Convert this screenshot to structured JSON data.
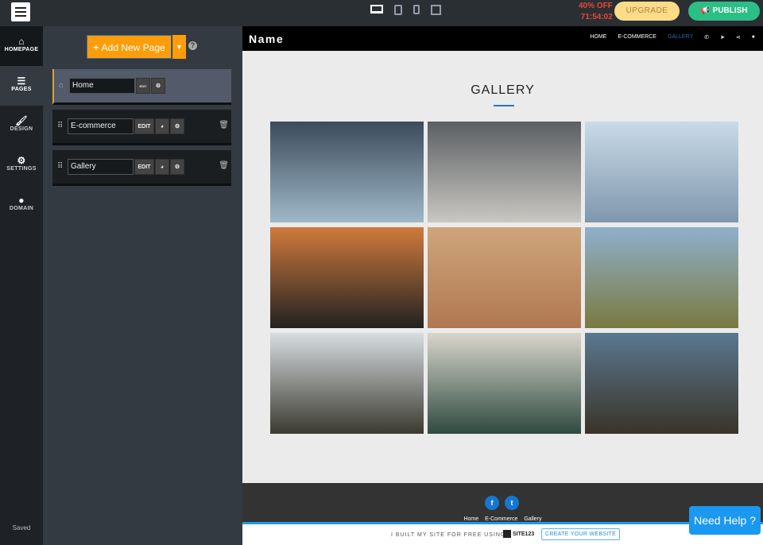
{
  "topbar": {
    "promo": "40% OFF",
    "timer": "71:54:02",
    "upgrade": "UPGRADE",
    "publish": "PUBLISH"
  },
  "rail": [
    {
      "label": "HOMEPAGE",
      "icon": "home-icon"
    },
    {
      "label": "PAGES",
      "icon": "pages-icon"
    },
    {
      "label": "DESIGN",
      "icon": "brush-icon"
    },
    {
      "label": "SETTINGS",
      "icon": "gear-icon"
    },
    {
      "label": "DOMAIN",
      "icon": "globe-icon"
    }
  ],
  "status": "Saved",
  "panel": {
    "add_label": "Add New Page",
    "help": "?",
    "pages": [
      {
        "name": "Home",
        "edit": "EDIT"
      },
      {
        "name": "E-commerce",
        "edit": "EDIT"
      },
      {
        "name": "Gallery",
        "edit": "EDIT"
      }
    ]
  },
  "site": {
    "name": "Name",
    "nav": [
      "HOME",
      "E-COMMERCE",
      "GALLERY"
    ],
    "gallery_title": "GALLERY",
    "images": [
      "#3b4b5c,#9fb8c8",
      "#5b5f63,#c9c7c2",
      "#c9dbe8,#7f97ad",
      "#d07a3c,#222",
      "#cfa57c,#b07850",
      "#8fb0cc,#7a7a40",
      "#d8dde0,#3a3a30",
      "#d9d6cc,#2f4a40",
      "#5a7890,#3a3428"
    ],
    "footer_links": [
      "Home",
      "E-Commerce",
      "Gallery"
    ],
    "credit": "I BUILT MY SITE FOR FREE USING",
    "brand": "SITE123",
    "cta": "CREATE YOUR WEBSITE"
  },
  "help_button": "Need Help ?"
}
